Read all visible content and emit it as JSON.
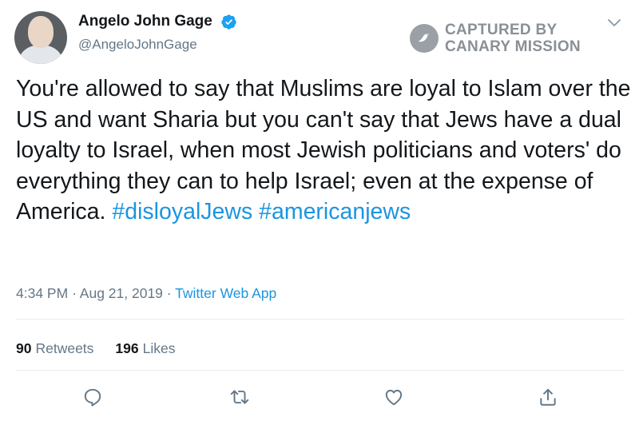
{
  "user": {
    "name": "Angelo John Gage",
    "handle": "@AngeloJohnGage"
  },
  "watermark": {
    "line1": "CAPTURED BY",
    "line2": "CANARY MISSION"
  },
  "tweet": {
    "text": "You're allowed to say that Muslims are loyal to Islam over the US and want Sharia but you can't say that Jews have a dual loyalty to Israel, when most Jewish politicians and voters' do everything they can to help Israel; even at the expense of America.",
    "hashtag1": "#disloyalJews",
    "hashtag2": "#americanjews"
  },
  "meta": {
    "time": "4:34 PM",
    "sep1": "·",
    "date": "Aug 21, 2019",
    "sep2": "·",
    "source": "Twitter Web App"
  },
  "stats": {
    "retweets_count": "90",
    "retweets_label": "Retweets",
    "likes_count": "196",
    "likes_label": "Likes"
  },
  "icons": [
    "verified-badge-icon",
    "canary-bird-icon",
    "chevron-down-icon",
    "reply-icon",
    "retweet-icon",
    "like-icon",
    "share-icon"
  ],
  "colors": {
    "link": "#1b95e0",
    "secondary_text": "#657786",
    "primary_text": "#14171a",
    "divider": "#e6ecf0",
    "watermark": "#8a9096"
  }
}
